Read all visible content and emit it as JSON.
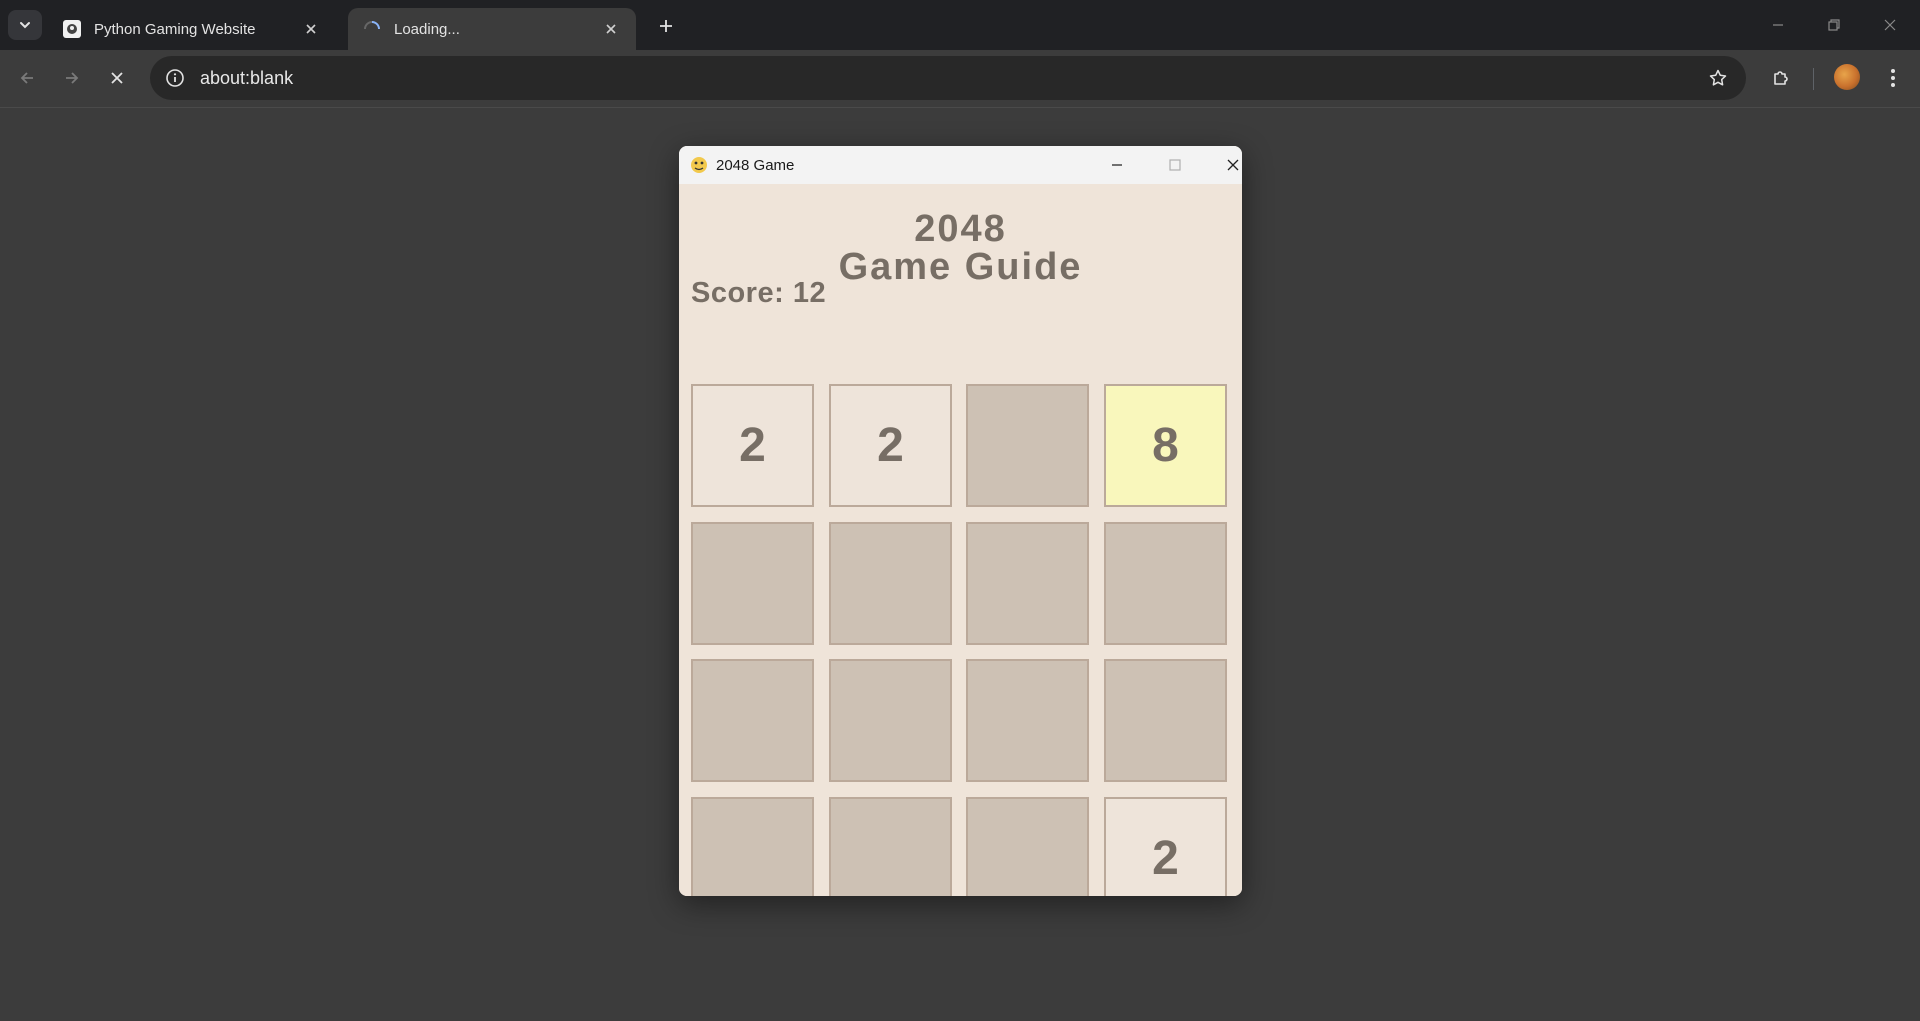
{
  "browser": {
    "tabs": [
      {
        "title": "Python Gaming Website",
        "state": "inactive",
        "icon": "site-favicon"
      },
      {
        "title": "Loading...",
        "state": "active",
        "icon": "loading-spinner-icon"
      }
    ],
    "address": {
      "url": "about:blank"
    }
  },
  "window": {
    "title": "2048 Game",
    "icon": "pygame-snake-icon"
  },
  "game": {
    "title_line1": "2048",
    "title_line2": "Game Guide",
    "score_text": "Score: 12",
    "board": [
      [
        "2",
        "2",
        "",
        "8"
      ],
      [
        "",
        "",
        "",
        ""
      ],
      [
        "",
        "",
        "",
        ""
      ],
      [
        "",
        "",
        "",
        "2"
      ]
    ]
  },
  "colors": {
    "tile_empty": "#cdc1b4",
    "tile_2": "#eee4da",
    "tile_8": "#f9f7bc",
    "tile_text": "#776e65",
    "board_bg": "#efe4d9"
  }
}
